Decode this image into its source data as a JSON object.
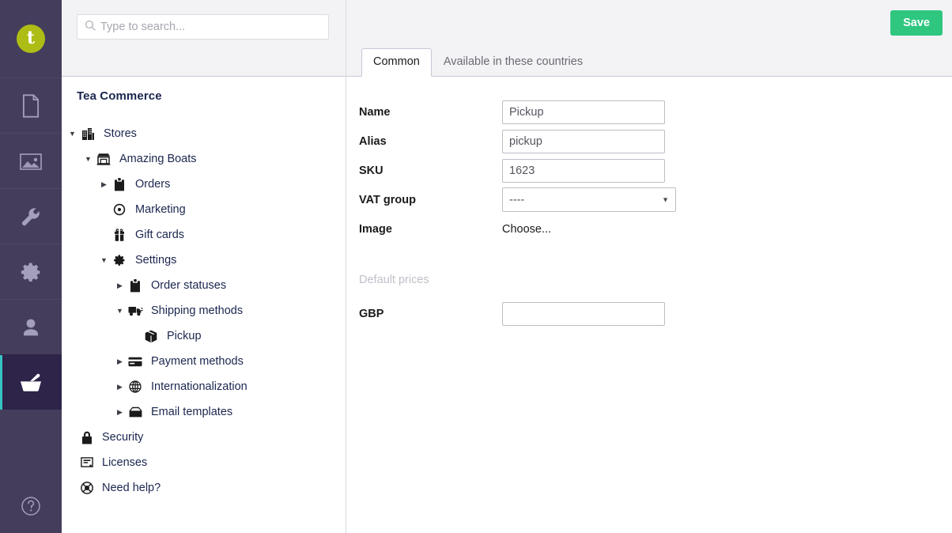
{
  "app": {
    "logo_glyph": "t",
    "logo_color": "#aebd15",
    "rail_bg": "#443d5c",
    "rail_active_bg": "#2e2349",
    "rail_active_accent": "#36c2c2",
    "sections": [
      {
        "name": "content-section",
        "icon": "document-icon",
        "active": false
      },
      {
        "name": "media-section",
        "icon": "image-icon",
        "active": false
      },
      {
        "name": "settings-section",
        "icon": "wrench-icon",
        "active": false
      },
      {
        "name": "developer-section",
        "icon": "gear-icon",
        "active": false
      },
      {
        "name": "users-section",
        "icon": "user-icon",
        "active": false
      },
      {
        "name": "commerce-section",
        "icon": "basket-icon",
        "active": true
      }
    ],
    "help_icon": "question-circle-icon"
  },
  "search": {
    "placeholder": "Type to search...",
    "value": "",
    "icon": "search-icon"
  },
  "tree": {
    "title": "Tea Commerce",
    "nodes": [
      {
        "label": "Stores",
        "icon": "stores-icon",
        "level": 0,
        "arrow": "down",
        "selected": false
      },
      {
        "label": "Amazing Boats",
        "icon": "store-icon",
        "level": 1,
        "arrow": "down",
        "selected": false
      },
      {
        "label": "Orders",
        "icon": "clipboard-icon",
        "level": 2,
        "arrow": "right",
        "selected": false
      },
      {
        "label": "Marketing",
        "icon": "target-icon",
        "level": 2,
        "arrow": "none",
        "selected": false
      },
      {
        "label": "Gift cards",
        "icon": "gift-icon",
        "level": 2,
        "arrow": "none",
        "selected": false
      },
      {
        "label": "Settings",
        "icon": "gear-icon",
        "level": 2,
        "arrow": "down",
        "selected": false
      },
      {
        "label": "Order statuses",
        "icon": "clipboard-icon",
        "level": 3,
        "arrow": "right",
        "selected": false
      },
      {
        "label": "Shipping methods",
        "icon": "truck-icon",
        "level": 3,
        "arrow": "down",
        "selected": false
      },
      {
        "label": "Pickup",
        "icon": "box-icon",
        "level": 4,
        "arrow": "none",
        "selected": true
      },
      {
        "label": "Payment methods",
        "icon": "credit-card-icon",
        "level": 3,
        "arrow": "right",
        "selected": false
      },
      {
        "label": "Internationalization",
        "icon": "globe-icon",
        "level": 3,
        "arrow": "right",
        "selected": false
      },
      {
        "label": "Email templates",
        "icon": "inbox-icon",
        "level": 3,
        "arrow": "right",
        "selected": false
      },
      {
        "label": "Security",
        "icon": "lock-icon",
        "level": 0,
        "arrow": "none",
        "selected": false,
        "flat": true
      },
      {
        "label": "Licenses",
        "icon": "license-icon",
        "level": 0,
        "arrow": "none",
        "selected": false,
        "flat": true
      },
      {
        "label": "Need help?",
        "icon": "lifebuoy-icon",
        "level": 0,
        "arrow": "none",
        "selected": false,
        "flat": true
      }
    ]
  },
  "main": {
    "save_label": "Save",
    "save_color": "#2fc780",
    "tabs": [
      {
        "label": "Common",
        "active": true
      },
      {
        "label": "Available in these countries",
        "active": false
      }
    ],
    "fields": [
      {
        "label": "Name",
        "type": "text",
        "value": "Pickup"
      },
      {
        "label": "Alias",
        "type": "text",
        "value": "pickup"
      },
      {
        "label": "SKU",
        "type": "text",
        "value": "1623"
      },
      {
        "label": "VAT group",
        "type": "select",
        "value": "----",
        "options": [
          "----"
        ]
      },
      {
        "label": "Image",
        "type": "static",
        "value": "Choose..."
      }
    ],
    "default_prices": {
      "section_label": "Default prices",
      "rows": [
        {
          "label": "GBP",
          "type": "text",
          "value": ""
        }
      ]
    }
  }
}
